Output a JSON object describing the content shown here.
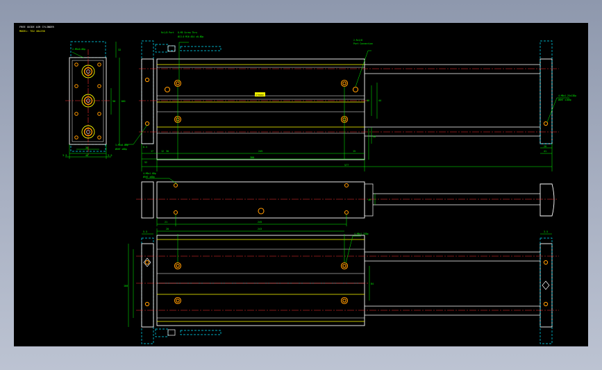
{
  "title_block": {
    "line1": "FREE GUIDE AIR CYLINDER",
    "line2": "MODEL: TGU 40x250"
  },
  "colors": {
    "background": "#000000",
    "outline": "#ffffff",
    "dimension": "#00ff00",
    "centerline": "#ff3030",
    "hidden": "#00e5ff",
    "highlight": "#ffff00",
    "detail": "#ff9900"
  },
  "side_view_notes": {
    "mounting": "2-M5x0.8Dp",
    "pin": "3-Ø6x0.8Dp",
    "bottom": "6-M6x1.0Dp"
  },
  "top_notes": {
    "port": "Rc1/8 Port",
    "cap_bolts": "8-M5 Screw Thru",
    "rod_end": "Ø13.0 M16 Ø14 x0.8Dp",
    "port_right": "2-Rc1/8",
    "port_right_sub": "Port Connection",
    "rod_thread": "4-M8x1.25x13Dp",
    "rod_thread_sub": "Ø8H7 x10Dp",
    "left_thread": "3-M5x0.8Dp",
    "left_thread_sub": "Ø5H7 x8Dp",
    "stroke_label": "STROKE"
  },
  "mid_notes": {
    "thread": "4-M6x1.0Dp",
    "thread_sub": "Ø5H7 x8Dp"
  },
  "bot_notes": {
    "thread": "4-M8x1.25Dp"
  },
  "dims": {
    "side_width": "32",
    "side_height": "100",
    "side_inner": "50",
    "side_bottom_a": "3.5",
    "side_bottom_b": "40",
    "side_bottom_c": "3.5",
    "side_pitch": "30",
    "top_a": "17",
    "top_b": "30",
    "top_c": "245",
    "top_d": "15",
    "top_e": "12",
    "top_overall": "300",
    "top_total": "577",
    "top_right_a": "41",
    "top_right_b": "20",
    "top_h1": "50",
    "top_h2": "44",
    "top_h3": "28",
    "top_h4": "84",
    "top_left_a": "6.5",
    "top_left_b": "52",
    "mid_a": "21",
    "mid_b": "245",
    "mid_h": "40",
    "bot_a": "20",
    "bot_b": "243",
    "bot_h": "100",
    "bot_h2": "84",
    "bot_w": "55",
    "bot_r": "3.5",
    "bot_l": "5.5"
  }
}
